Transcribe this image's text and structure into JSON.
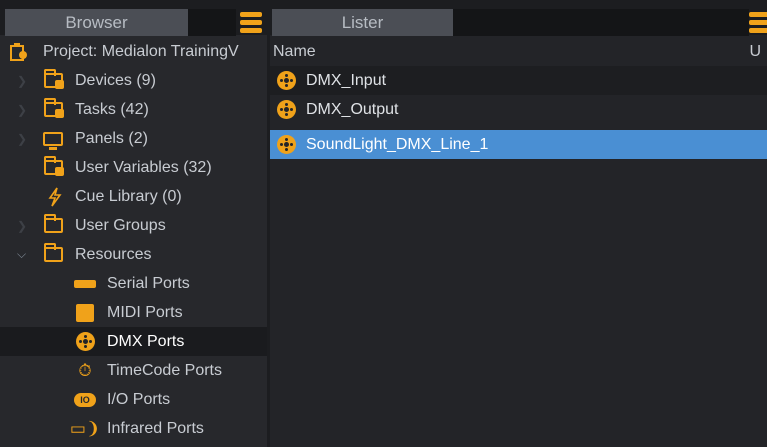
{
  "browser": {
    "tab_label": "Browser",
    "project_label": "Project: Medialon TrainingV",
    "items": [
      {
        "label": "Devices (9)",
        "icon": "folder-gear-icon"
      },
      {
        "label": "Tasks (42)",
        "icon": "folder-tasks-icon"
      },
      {
        "label": "Panels (2)",
        "icon": "monitor-icon"
      },
      {
        "label": "User Variables (32)",
        "icon": "folder-variables-icon"
      },
      {
        "label": "Cue Library (0)",
        "icon": "lightning-icon"
      },
      {
        "label": "User Groups",
        "icon": "folder-icon"
      },
      {
        "label": "Resources",
        "icon": "folder-open-icon"
      }
    ],
    "resources": [
      {
        "label": "Serial Ports",
        "icon": "serial-port-icon"
      },
      {
        "label": "MIDI Ports",
        "icon": "midi-port-icon"
      },
      {
        "label": "DMX Ports",
        "icon": "dmx-port-icon"
      },
      {
        "label": "TimeCode Ports",
        "icon": "timecode-icon"
      },
      {
        "label": "I/O Ports",
        "icon": "io-port-icon"
      },
      {
        "label": "Infrared Ports",
        "icon": "infrared-icon"
      }
    ],
    "io_text": "IO"
  },
  "lister": {
    "tab_label": "Lister",
    "column_name": "Name",
    "column_u": "U",
    "rows": [
      {
        "label": "DMX_Input"
      },
      {
        "label": "DMX_Output"
      },
      {
        "label": "SoundLight_DMX_Line_1"
      }
    ]
  },
  "colors": {
    "accent": "#f0a21a",
    "selection": "#4a8fd3"
  }
}
